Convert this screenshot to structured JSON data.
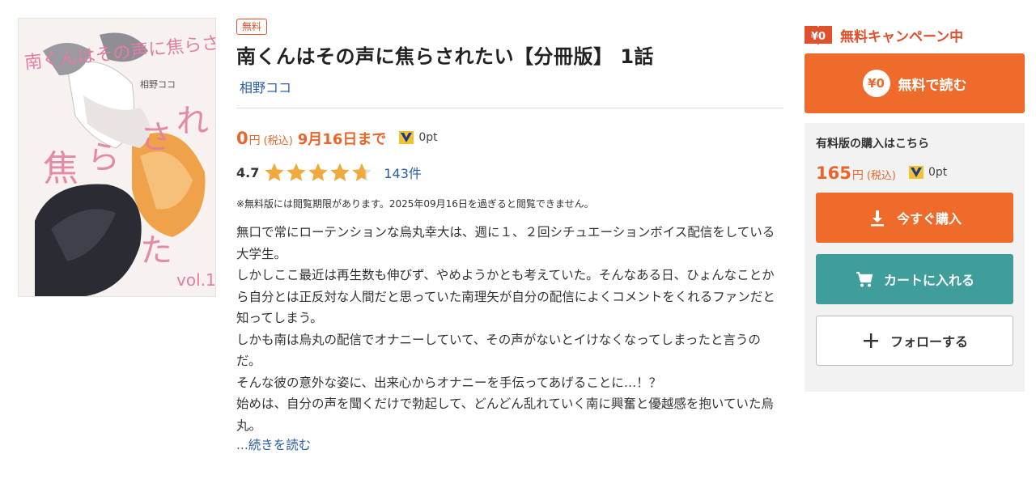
{
  "cover": {
    "title_text": "南くんはその声に焦らされたい",
    "author_text": "相野ココ",
    "volume_text": "vol.1"
  },
  "product": {
    "badge": "無料",
    "title": "南くんはその声に焦らされたい【分冊版】 1話",
    "author": "相野ココ"
  },
  "price": {
    "amount": "0",
    "yen": "円",
    "tax": "(税込)",
    "until": "9月16日まで",
    "points": "0pt"
  },
  "rating": {
    "score": "4.7",
    "stars": 4.7,
    "count": "143件"
  },
  "notice": "※無料版には閲覧期限があります。2025年09月16日を過ぎると閲覧できません。",
  "description": [
    "無口で常にローテンションな烏丸幸大は、週に１、２回シチュエーションボイス配信をしている大学生。",
    "しかしここ最近は再生数も伸びず、やめようかとも考えていた。そんなある日、ひょんなことから自分とは正反対な人間だと思っていた南理矢が自分の配信によくコメントをくれるファンだと知ってしまう。",
    "しかも南は烏丸の配信でオナニーしていて、その声がないとイけなくなってしまったと言うのだ。",
    "そんな彼の意外な姿に、出来心からオナニーを手伝ってあげることに…！？",
    "始めは、自分の声を聞くだけで勃起して、どんどん乱れていく南に興奮と優越感を抱いていた烏丸。"
  ],
  "read_more": "...続きを読む",
  "sidebar": {
    "campaign_tag": "¥0",
    "campaign_text": "無料キャンペーン中",
    "free_icon": "¥0",
    "free_button": "無料で読む",
    "paid_heading": "有料版の購入はこちら",
    "paid_amount": "165",
    "paid_yen": "円",
    "paid_tax": "(税込)",
    "paid_points": "0pt",
    "buy_button": "今すぐ購入",
    "cart_button": "カートに入れる",
    "follow_button": "フォローする"
  },
  "colors": {
    "accent": "#ee6b2b",
    "price": "#e8662b",
    "link": "#2a5ea8",
    "cart": "#3f9e9b",
    "star": "#f2a93b"
  },
  "icons": [
    "point-v-icon",
    "star-icon",
    "download-icon",
    "cart-icon",
    "plus-icon",
    "free-tag-icon"
  ]
}
